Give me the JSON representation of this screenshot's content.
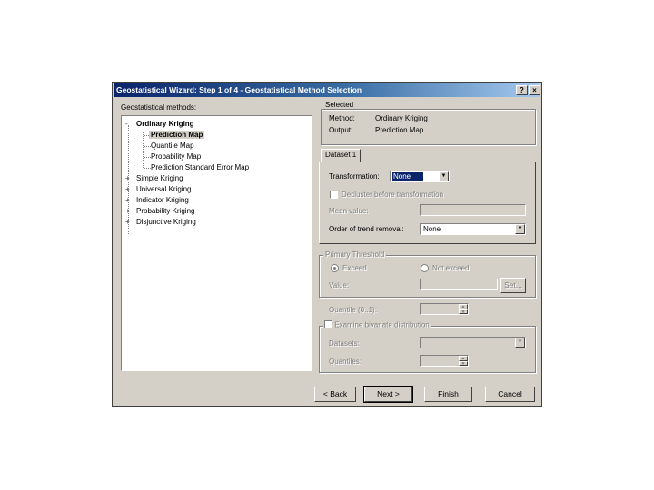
{
  "window": {
    "title": "Geostatistical Wizard: Step 1 of 4 - Geostatistical Method Selection",
    "help_label": "?",
    "close_label": "×"
  },
  "methods": {
    "label": "Geostatistical methods:",
    "tree": [
      {
        "label": "Ordinary Kriging",
        "expander": "-"
      },
      {
        "label": "Prediction Map"
      },
      {
        "label": "Quantile Map"
      },
      {
        "label": "Probability Map"
      },
      {
        "label": "Prediction Standard Error Map"
      },
      {
        "label": "Simple Kriging",
        "expander": "+"
      },
      {
        "label": "Universal Kriging",
        "expander": "+"
      },
      {
        "label": "Indicator Kriging",
        "expander": "+"
      },
      {
        "label": "Probability Kriging",
        "expander": "+"
      },
      {
        "label": "Disjunctive Kriging",
        "expander": "+"
      }
    ]
  },
  "selected": {
    "legend": "Selected",
    "method_label": "Method:",
    "method_value": "Ordinary Kriging",
    "output_label": "Output:",
    "output_value": "Prediction Map"
  },
  "dataset_tab": {
    "tab_label": "Dataset 1",
    "transformation_label": "Transformation:",
    "transformation_value": "None",
    "decluster_label": "Decluster before transformation",
    "mean_value_label": "Mean value:",
    "mean_value": "",
    "order_label": "Order of trend removal:",
    "order_value": "None"
  },
  "threshold": {
    "legend": "Primary Threshold",
    "exceed_label": "Exceed",
    "not_exceed_label": "Not exceed",
    "value_label": "Value:",
    "value": "",
    "set_label": "Set..."
  },
  "quantile": {
    "label": "Quantile (0..1):",
    "value": ""
  },
  "bivariate": {
    "legend": "Examine bivariate distribution",
    "datasets_label": "Datasets:",
    "datasets_value": "",
    "quantiles_label": "Quantiles:",
    "quantiles_value": ""
  },
  "buttons": {
    "back": "< Back",
    "next": "Next >",
    "finish": "Finish",
    "cancel": "Cancel"
  }
}
